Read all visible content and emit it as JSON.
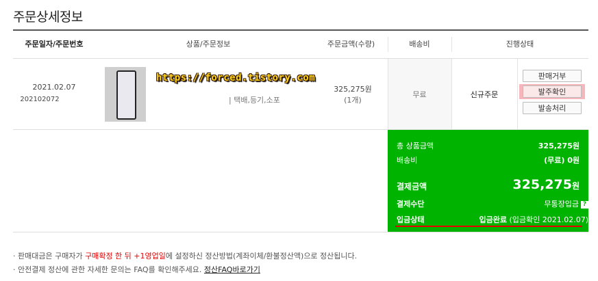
{
  "title": "주문상세정보",
  "headers": {
    "order_date_no": "주문일자/주문번호",
    "product_info": "상품/주문정보",
    "order_amount": "주문금액(수량)",
    "shipping": "배송비",
    "status": "진행상태"
  },
  "order": {
    "date": "2021.02.07",
    "number": "202102072",
    "watermark": "https://forced.tistory.com",
    "delivery_tags": "| 택배,등기,소포",
    "amount": "325,275원",
    "quantity": "(1개)",
    "shipping_fee": "무료",
    "status": "신규주문"
  },
  "actions": {
    "reject": "판매거부",
    "confirm": "발주확인",
    "ship": "발송처리"
  },
  "summary": {
    "total_label": "총 상품금액",
    "total_value": "325,275원",
    "shipping_label": "배송비",
    "shipping_value": "(무료) 0원",
    "payment_label": "결제금액",
    "payment_value": "325,275",
    "payment_unit": "원",
    "method_label": "결제수단",
    "method_value": "무통장입금",
    "deposit_label": "입금상태",
    "deposit_value": "입금완료",
    "deposit_detail": "(입금확인 2021.02.07)"
  },
  "notes": {
    "line1_a": "판매대금은 구매자가 ",
    "line1_red": "구매확정 한 뒤 +1영업일",
    "line1_b": "에 설정하신 정산방법(계좌이체/환불정산액)으로 정산됩니다.",
    "line2": "안전결제 정산에 관한 자세한 문의는 FAQ를 확인해주세요.",
    "line2_link": "정산FAQ바로가기"
  },
  "colors": {
    "summary_bg": "#00b300",
    "highlight": "#f7b6bb",
    "underline": "#e60000"
  },
  "icons": {
    "help": "question-icon"
  }
}
